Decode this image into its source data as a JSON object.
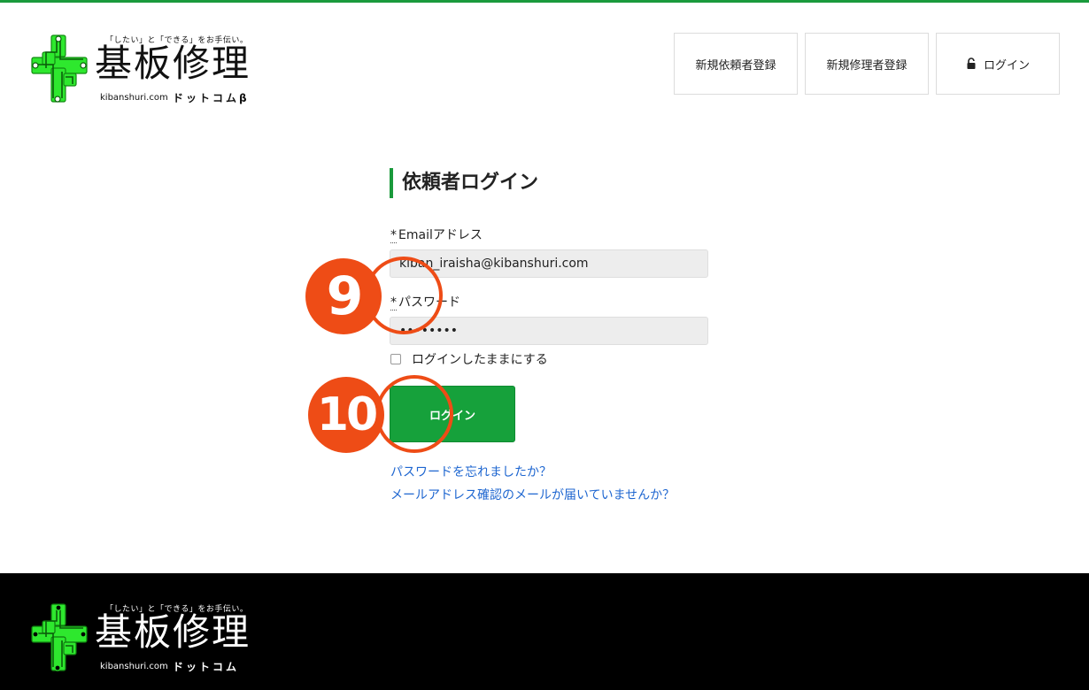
{
  "brand": {
    "tagline": "「したい」と「できる」をお手伝い。",
    "name": "基板修理",
    "domain": "kibanshuri.com",
    "kana_header": "ドットコムβ",
    "kana_footer": "ドットコム",
    "accent_color": "#1a9a3c",
    "logo_color": "#2ee82e"
  },
  "nav": {
    "requester_register": "新規依頼者登録",
    "repairer_register": "新規修理者登録",
    "login_icon": "lock-icon",
    "login": "ログイン"
  },
  "form": {
    "title": "依頼者ログイン",
    "required_mark": "*",
    "email_label": "Emailアドレス",
    "email_value": "kiban_iraisha@kibanshuri.com",
    "password_label": "パスワード",
    "password_value": "••••••••",
    "remember_label": "ログインしたままにする",
    "remember_checked": false,
    "submit_label": "ログイン",
    "submit_color": "#16a13b"
  },
  "links": {
    "forgot_password": "パスワードを忘れましたか？",
    "resend_confirmation": "メールアドレス確認のメールが届いていませんか？",
    "link_color": "#1e66d0"
  },
  "annotations": {
    "step_password": "9",
    "step_submit": "10",
    "color": "#ee4c16"
  }
}
